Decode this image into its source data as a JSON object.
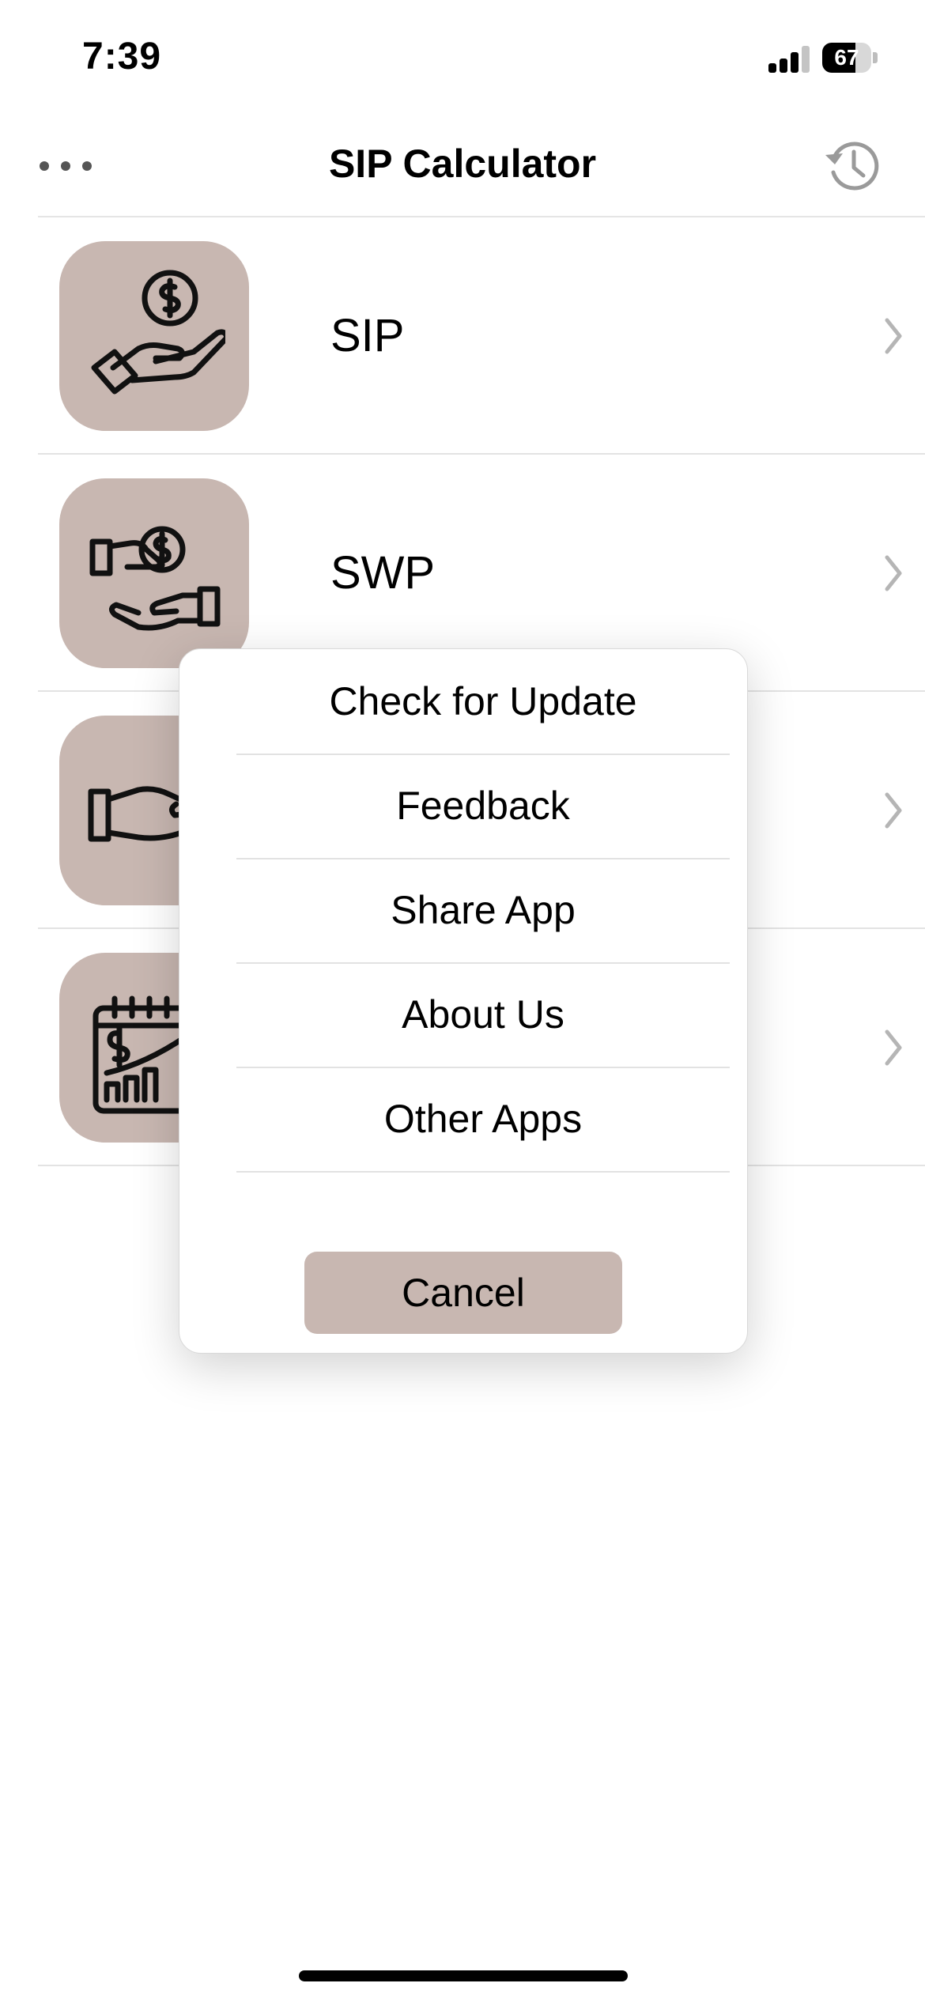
{
  "status_bar": {
    "time": "7:39",
    "battery": "67"
  },
  "nav": {
    "title": "SIP Calculator",
    "more_icon": "ellipsis-icon",
    "history_icon": "history-icon"
  },
  "list": {
    "items": [
      {
        "label": "SIP",
        "icon": "hand-coin-icon"
      },
      {
        "label": "SWP",
        "icon": "hand-giving-coin-icon"
      },
      {
        "label": "",
        "icon": "hand-receive-icon"
      },
      {
        "label": "",
        "icon": "calendar-chart-icon"
      }
    ]
  },
  "action_sheet": {
    "items": [
      "Check for Update",
      "Feedback",
      "Share App",
      "About Us",
      "Other Apps"
    ],
    "cancel_label": "Cancel"
  },
  "colors": {
    "accent": "#c8b7b1",
    "background": "#ffffff",
    "text": "#000000"
  }
}
